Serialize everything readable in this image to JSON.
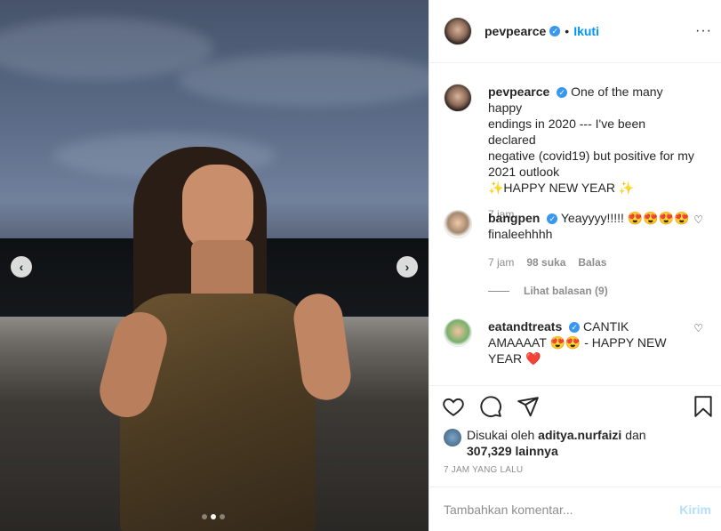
{
  "post": {
    "username": "pevpearce",
    "follow_label": "Ikuti",
    "more_icon": "more-horizontal-icon",
    "caption_lines": [
      "One of the many happy",
      "endings in 2020 --- I've been declared",
      "negative (covid19) but positive for my",
      "2021 outlook"
    ],
    "caption_tail": "✨HAPPY NEW YEAR ✨",
    "caption_time": "7 jam"
  },
  "comments": [
    {
      "username": "bangpen",
      "text": "Yeayyyy!!!!! 😍😍😍😍",
      "text2": "finaleehhhh",
      "time": "7 jam",
      "likes": "98 suka",
      "reply": "Balas",
      "view_replies": "Lihat balasan (9)"
    },
    {
      "username": "eatandtreats",
      "text": "CANTIK",
      "text2": "AMAAAAT 😍😍 - HAPPY NEW",
      "text3": "YEAR ❤️"
    }
  ],
  "actions": {
    "liked_by_prefix": "Disukai oleh",
    "liked_by_user": "aditya.nurfaizi",
    "liked_by_join": "dan",
    "others": "307,329 lainnya",
    "timestamp": "7 JAM YANG LALU"
  },
  "composer": {
    "placeholder": "Tambahkan komentar...",
    "send": "Kirim"
  },
  "carousel": {
    "dots": 3,
    "active": 1
  }
}
